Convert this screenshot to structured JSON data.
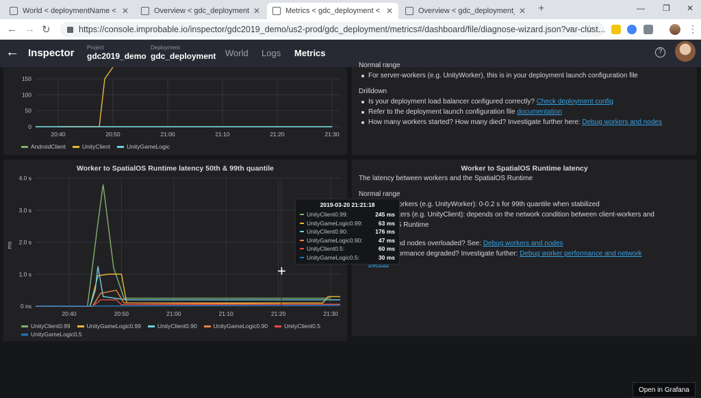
{
  "browser": {
    "tabs": [
      {
        "label": "World < deploymentName < pro",
        "active": false
      },
      {
        "label": "Overview < gdc_deployment < g",
        "active": false
      },
      {
        "label": "Metrics < gdc_deployment < gd",
        "active": true
      },
      {
        "label": "Overview < gdc_deployment_sm",
        "active": false
      }
    ],
    "url": "https://console.improbable.io/inspector/gdc2019_demo/us2-prod/gdc_deployment/metrics#/dashboard/file/diagnose-wizard.json?var-clust..."
  },
  "header": {
    "title": "Inspector",
    "project_label": "Project",
    "project_value": "gdc2019_demo",
    "deployment_label": "Deployment",
    "deployment_value": "gdc_deployment",
    "nav": [
      "World",
      "Logs",
      "Metrics"
    ],
    "active_nav": "Metrics",
    "help_glyph": "?"
  },
  "colors": {
    "green": "#7eb26d",
    "yellow": "#eab839",
    "cyan": "#6ed0e0",
    "orange": "#ef843c",
    "red": "#e24d42",
    "blue": "#1f78c1",
    "link": "#33a2e5"
  },
  "top_chart": {
    "legend": [
      "AndroidClient",
      "UnityClient",
      "UnityGameLogic"
    ],
    "chart_data": {
      "type": "line",
      "yticks": [
        "150",
        "100",
        "50",
        "0"
      ],
      "xticks": [
        "20:40",
        "20:50",
        "21:00",
        "21:10",
        "21:20",
        "21:30"
      ],
      "series": [
        {
          "name": "AndroidClient",
          "color": "#7eb26d",
          "points": [
            [
              0,
              0
            ],
            [
              1,
              0
            ],
            [
              2,
              0
            ],
            [
              3,
              0
            ],
            [
              4,
              0
            ],
            [
              5,
              0
            ],
            [
              6,
              0
            ]
          ]
        },
        {
          "name": "UnityClient",
          "color": "#eab839",
          "points": [
            [
              1,
              0
            ],
            [
              1.75,
              0
            ],
            [
              1.85,
              150
            ],
            [
              2,
              210
            ]
          ]
        },
        {
          "name": "UnityGameLogic",
          "color": "#6ed0e0",
          "points": [
            [
              0,
              0
            ],
            [
              1,
              0
            ],
            [
              2,
              0
            ],
            [
              3,
              0
            ],
            [
              4,
              0
            ],
            [
              5,
              0
            ],
            [
              6,
              0
            ]
          ]
        }
      ]
    }
  },
  "top_text": {
    "partial_heading": "Normal range",
    "normal_items": [
      "For server-workers (e.g. UnityWorker), this is in your deployment launch configuration file"
    ],
    "drilldown_heading": "Drilldown",
    "drilldown_items": [
      {
        "text": "Is your deployment load balancer configured correctly?",
        "link": "Check deployment config"
      },
      {
        "text": "Refer to the deployment launch configuration file",
        "link": "documentation"
      },
      {
        "text": "How many workers started? How many died? Investigate further here:",
        "link": "Debug workers and nodes"
      }
    ]
  },
  "latency_chart": {
    "title": "Worker to SpatialOS Runtime latency 50th & 99th quantile",
    "ylabel": "ms",
    "legend": [
      "UnityClient0.99",
      "UnityGameLogic0.99",
      "UnityClient0.90",
      "UnityGameLogic0.90",
      "UnityClient0.5",
      "UnityGameLogic0.5"
    ],
    "chart_data": {
      "type": "line",
      "yticks": [
        "4.0 s",
        "3.0 s",
        "2.0 s",
        "1.0 s",
        "0 ns"
      ],
      "xticks": [
        "20:40",
        "20:50",
        "21:00",
        "21:10",
        "21:20",
        "21:30"
      ],
      "series": [
        {
          "name": "UnityClient0.99",
          "color": "#7eb26d",
          "points": [
            [
              0,
              0
            ],
            [
              1.35,
              0
            ],
            [
              1.55,
              2.6
            ],
            [
              1.65,
              3.8
            ],
            [
              1.75,
              2.5
            ],
            [
              1.85,
              1.2
            ],
            [
              2.05,
              0.25
            ],
            [
              6,
              0.25
            ]
          ]
        },
        {
          "name": "UnityGameLogic0.99",
          "color": "#eab839",
          "points": [
            [
              0,
              0
            ],
            [
              1.4,
              0
            ],
            [
              1.55,
              0.95
            ],
            [
              1.75,
              1.0
            ],
            [
              2.0,
              1.0
            ],
            [
              2.1,
              0.1
            ],
            [
              5.85,
              0.1
            ],
            [
              5.95,
              0.3
            ],
            [
              6.3,
              0.3
            ]
          ]
        },
        {
          "name": "UnityClient0.90",
          "color": "#6ed0e0",
          "points": [
            [
              0,
              0
            ],
            [
              1.4,
              0
            ],
            [
              1.5,
              0.5
            ],
            [
              1.55,
              1.25
            ],
            [
              1.65,
              0.3
            ],
            [
              2.1,
              0.2
            ],
            [
              6.3,
              0.2
            ]
          ]
        },
        {
          "name": "UnityGameLogic0.90",
          "color": "#ef843c",
          "points": [
            [
              0,
              0
            ],
            [
              1.45,
              0
            ],
            [
              1.6,
              0.4
            ],
            [
              1.9,
              0.5
            ],
            [
              2.05,
              0.1
            ],
            [
              6.3,
              0.05
            ]
          ]
        },
        {
          "name": "UnityClient0.5",
          "color": "#e24d42",
          "points": [
            [
              0,
              0
            ],
            [
              1.45,
              0
            ],
            [
              1.6,
              0.2
            ],
            [
              1.9,
              0.2
            ],
            [
              2.0,
              0.05
            ],
            [
              6.3,
              0.06
            ]
          ]
        },
        {
          "name": "UnityGameLogic0.5",
          "color": "#1f78c1",
          "points": [
            [
              0,
              0
            ],
            [
              6.3,
              0.03
            ]
          ]
        }
      ]
    }
  },
  "tooltip": {
    "time": "2019-03-20 21:21:18",
    "rows": [
      {
        "name": "UnityClient0.99:",
        "value": "245 ms",
        "color": "#7eb26d"
      },
      {
        "name": "UnityGameLogic0.99:",
        "value": "63 ms",
        "color": "#eab839"
      },
      {
        "name": "UnityClient0.90:",
        "value": "176 ms",
        "color": "#6ed0e0"
      },
      {
        "name": "UnityGameLogic0.90:",
        "value": "47 ms",
        "color": "#ef843c"
      },
      {
        "name": "UnityClient0.5:",
        "value": "60 ms",
        "color": "#e24d42"
      },
      {
        "name": "UnityGameLogic0.5:",
        "value": "30 ms",
        "color": "#1f78c1"
      }
    ]
  },
  "latency_text": {
    "title": "Worker to SpatialOS Runtime latency",
    "description": "The latency between workers and the SpatialOS Runtime",
    "normal_heading": "Normal range",
    "line1": "-workers (e.g. UnityWorker): 0-0.2 s for 99th quantile when stabilized",
    "line2": "workers (e.g. UnityClient): depends on the network condition between client-workers and",
    "line3": "OS Runtime",
    "line4_text": "rs and nodes overloaded? See:",
    "line4_link": "Debug workers and nodes",
    "line5_text": "performance degraded? Investigate further:",
    "line5_link": "Debug worker performance and network",
    "line6_link": "egress"
  },
  "footer": {
    "grafana_button": "Open in Grafana"
  }
}
